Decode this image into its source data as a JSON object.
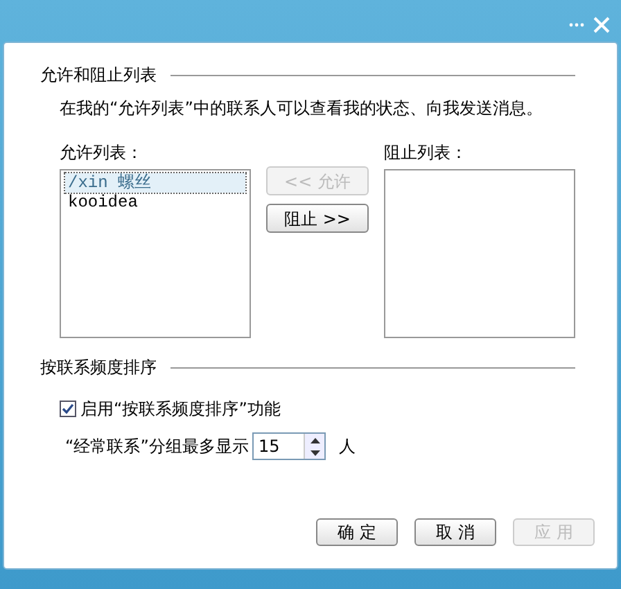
{
  "allow_block": {
    "title": "允许和阻止列表",
    "description": "在我的“允许列表”中的联系人可以查看我的状态、向我发送消息。",
    "allow_list": {
      "label": "允许列表：",
      "items": [
        {
          "text": "/xin 螺丝",
          "selected": true
        },
        {
          "text": "kooidea",
          "selected": false
        }
      ]
    },
    "buttons": [
      {
        "label": "<< 允许",
        "disabled": true
      },
      {
        "label": "阻止 >>",
        "disabled": false
      }
    ],
    "block_list": {
      "label": "阻止列表："
    }
  },
  "sort": {
    "title": "按联系频度排序",
    "checkbox": {
      "label": "启用“按联系频度排序”功能",
      "checked": true
    },
    "limit": {
      "label": "“经常联系”分组最多显示",
      "value": "15",
      "unit": "人"
    }
  },
  "footer_buttons": [
    {
      "label": "确 定",
      "disabled": false
    },
    {
      "label": "取 消",
      "disabled": false
    },
    {
      "label": "应 用",
      "disabled": true
    }
  ]
}
